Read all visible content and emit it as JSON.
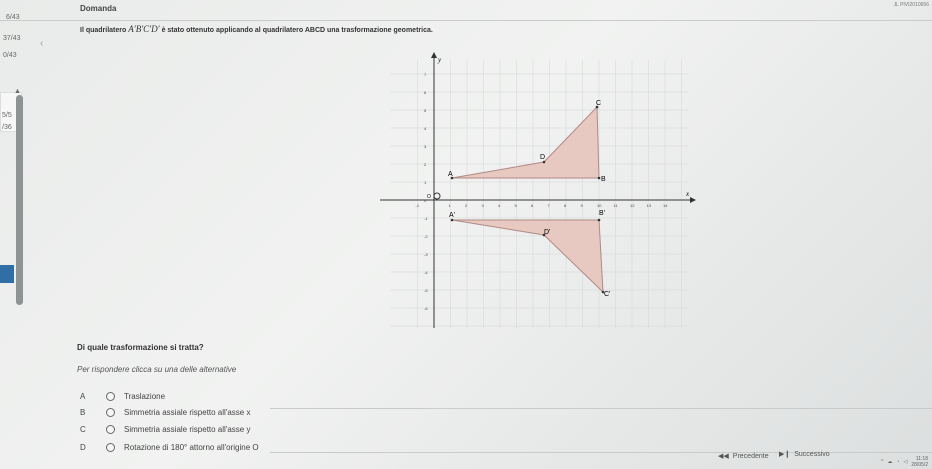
{
  "header": {
    "title": "Domanda",
    "corner_code": "JL PIVI2010656"
  },
  "sidebar": {
    "items": [
      "6/43",
      "37/43",
      "0/43",
      "5/5",
      "/36"
    ]
  },
  "question": {
    "prefix": "Il quadrilatero",
    "shape": "A′B′C′D′",
    "suffix": "è stato ottenuto applicando al quadrilatero ABCD una trasformazione geometrica."
  },
  "graph": {
    "x_label": "x",
    "y_label": "y",
    "origin_label": "O",
    "x_ticks": [
      "-1",
      "1",
      "2",
      "3",
      "4",
      "5",
      "6",
      "7",
      "8",
      "9",
      "10",
      "11",
      "12",
      "13",
      "14"
    ],
    "y_ticks": [
      "7",
      "6",
      "5",
      "4",
      "3",
      "2",
      "1",
      "0",
      "-1",
      "-2",
      "-3",
      "-4",
      "-5",
      "-6"
    ],
    "points": {
      "A": "A",
      "B": "B",
      "C": "C",
      "D": "D",
      "A1": "A'",
      "B1": "B'",
      "C1": "C'",
      "D1": "D'"
    },
    "colors": {
      "fill": "#e8c9c2",
      "stroke": "#b08a84",
      "axis": "#333333",
      "grid": "#d3d6d6"
    }
  },
  "prompt": "Di quale trasformazione si tratta?",
  "hint": "Per rispondere clicca su una delle alternative",
  "options": [
    {
      "letter": "A",
      "text": "Traslazione"
    },
    {
      "letter": "B",
      "text": "Simmetria assiale rispetto all'asse x"
    },
    {
      "letter": "C",
      "text": "Simmetria assiale rispetto all'asse y"
    },
    {
      "letter": "D",
      "text": "Rotazione di 180° attorno all'origine O"
    }
  ],
  "nav": {
    "prev": "Precedente",
    "next": "Successivo"
  },
  "taskbar": {
    "time": "11:18",
    "date": "28/05/2"
  }
}
